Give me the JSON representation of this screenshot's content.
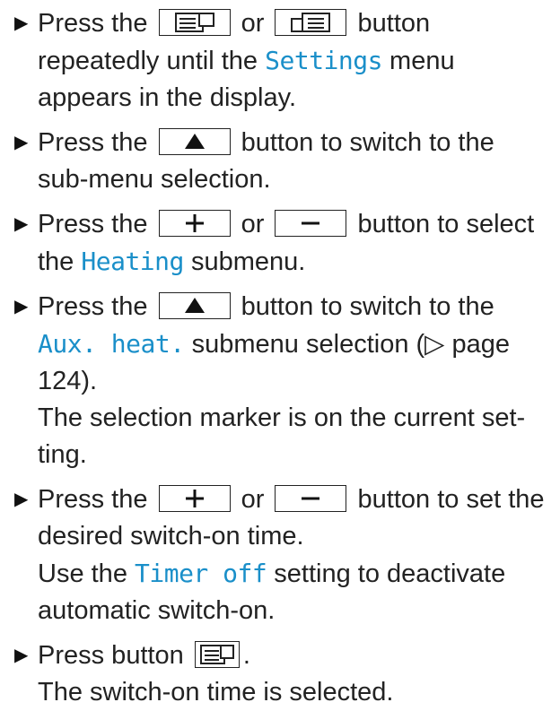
{
  "steps": [
    {
      "before": "Press the ",
      "key1": "display-left-icon",
      "mid": " or ",
      "key2": "display-right-icon",
      "after": " button repeatedly until the ",
      "menu": "Settings",
      "tail": " menu appears in the display."
    },
    {
      "before": "Press the ",
      "key1": "up-triangle-icon",
      "after": " button to switch to the sub-menu selection."
    },
    {
      "before": "Press the ",
      "key1": "plus-icon",
      "mid": " or ",
      "key2": "minus-icon",
      "after": " button to select the ",
      "menu": "Heating",
      "tail": " submenu."
    },
    {
      "before": "Press the ",
      "key1": "up-triangle-icon",
      "after": " button to switch to the ",
      "menu": "Aux. heat.",
      "tail": " submenu selection (",
      "page_ref": "▷ page 124",
      "tail2": ").",
      "note": "The selection marker is on the current set-ting."
    },
    {
      "before": "Press the ",
      "key1": "plus-icon",
      "mid": " or ",
      "key2": "minus-icon",
      "after": " button to set the desired switch-on time.",
      "note_before": "Use the ",
      "menu": "Timer off",
      "note_after": " setting to deactivate automatic switch-on."
    },
    {
      "before": "Press button ",
      "key1": "display-left-icon",
      "after": ".",
      "note": "The switch-on time is selected."
    }
  ],
  "bullet": "▶"
}
